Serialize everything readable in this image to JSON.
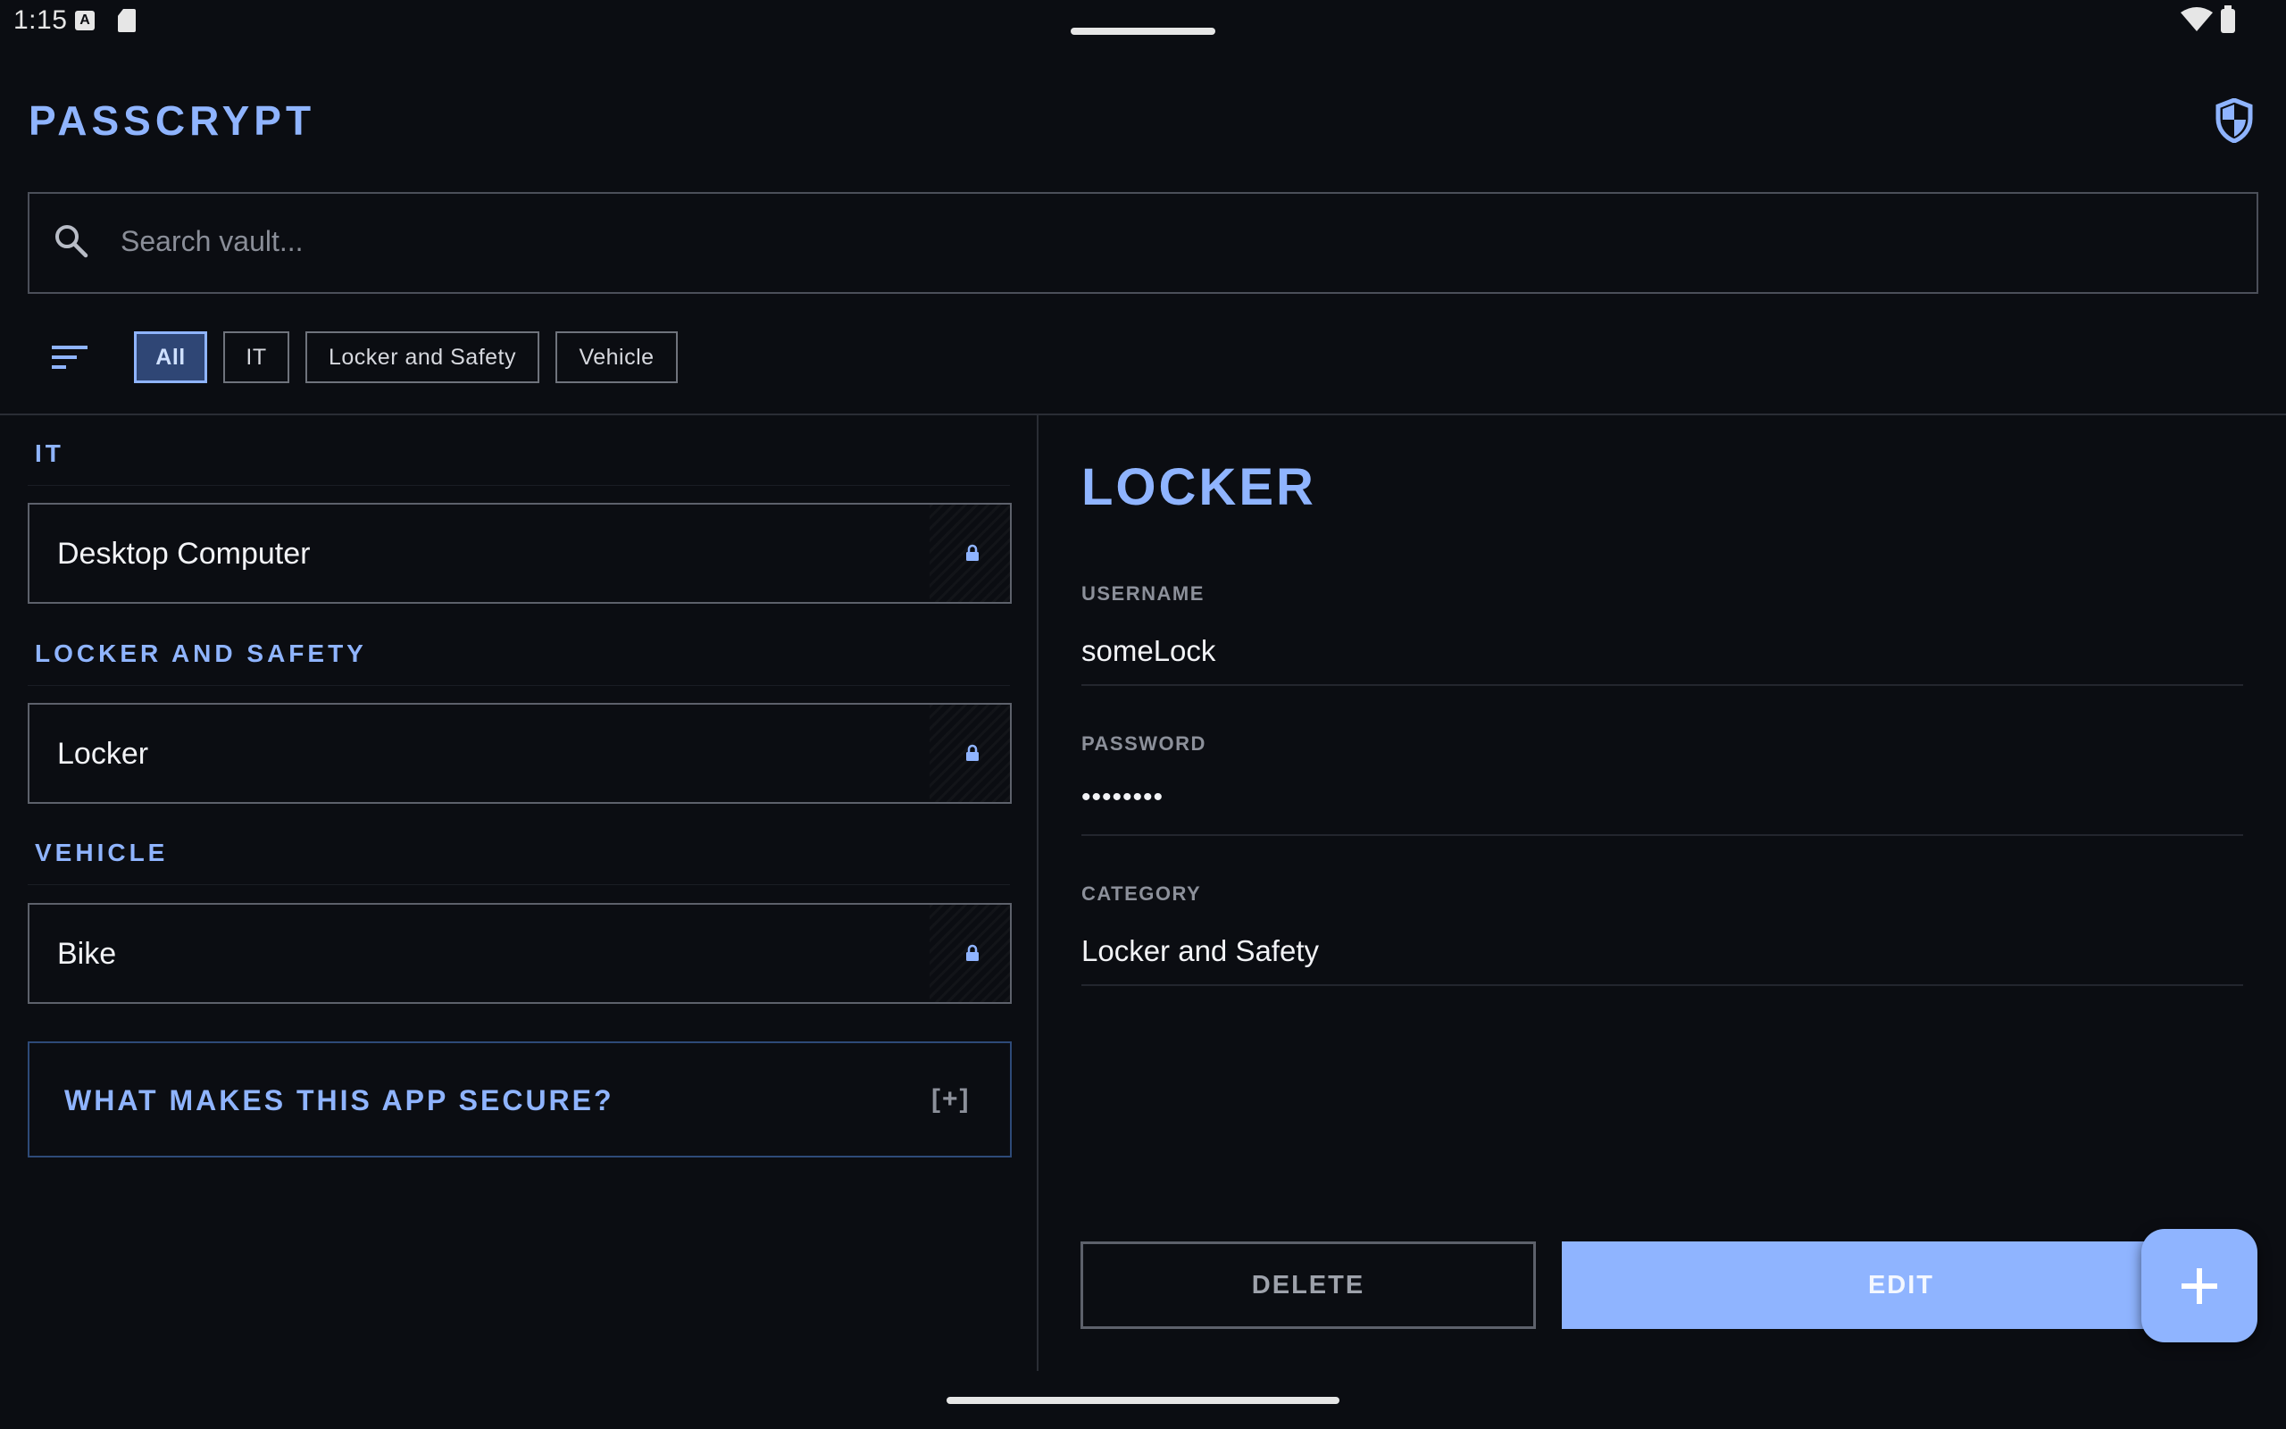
{
  "status_bar": {
    "time": "1:15",
    "icons": [
      "a-notification-icon",
      "sd-card-icon",
      "wifi-icon",
      "battery-icon"
    ]
  },
  "app": {
    "title": "PASSCRYPT",
    "header_icon": "shield-icon",
    "accent_color": "#8fb4ff",
    "background_color": "#0b0d12"
  },
  "search": {
    "placeholder": "Search vault...",
    "value": ""
  },
  "filters": {
    "sort_icon": "sort-icon",
    "chips": [
      {
        "label": "All",
        "active": true
      },
      {
        "label": "IT",
        "active": false
      },
      {
        "label": "Locker and Safety",
        "active": false
      },
      {
        "label": "Vehicle",
        "active": false
      }
    ]
  },
  "vault": {
    "sections": [
      {
        "heading": "IT",
        "entries": [
          {
            "label": "Desktop Computer",
            "icon": "lock-icon"
          }
        ]
      },
      {
        "heading": "LOCKER AND SAFETY",
        "entries": [
          {
            "label": "Locker",
            "icon": "lock-icon"
          }
        ]
      },
      {
        "heading": "VEHICLE",
        "entries": [
          {
            "label": "Bike",
            "icon": "lock-icon"
          }
        ]
      }
    ],
    "info_panel": {
      "label": "WHAT MAKES THIS APP SECURE?",
      "toggle": "[+]"
    }
  },
  "detail": {
    "title": "LOCKER",
    "fields": [
      {
        "label": "USERNAME",
        "value": "someLock"
      },
      {
        "label": "PASSWORD",
        "value": "••••••••"
      },
      {
        "label": "CATEGORY",
        "value": "Locker and Safety"
      }
    ],
    "delete_label": "DELETE",
    "edit_label": "EDIT",
    "fab_icon": "plus-icon"
  }
}
